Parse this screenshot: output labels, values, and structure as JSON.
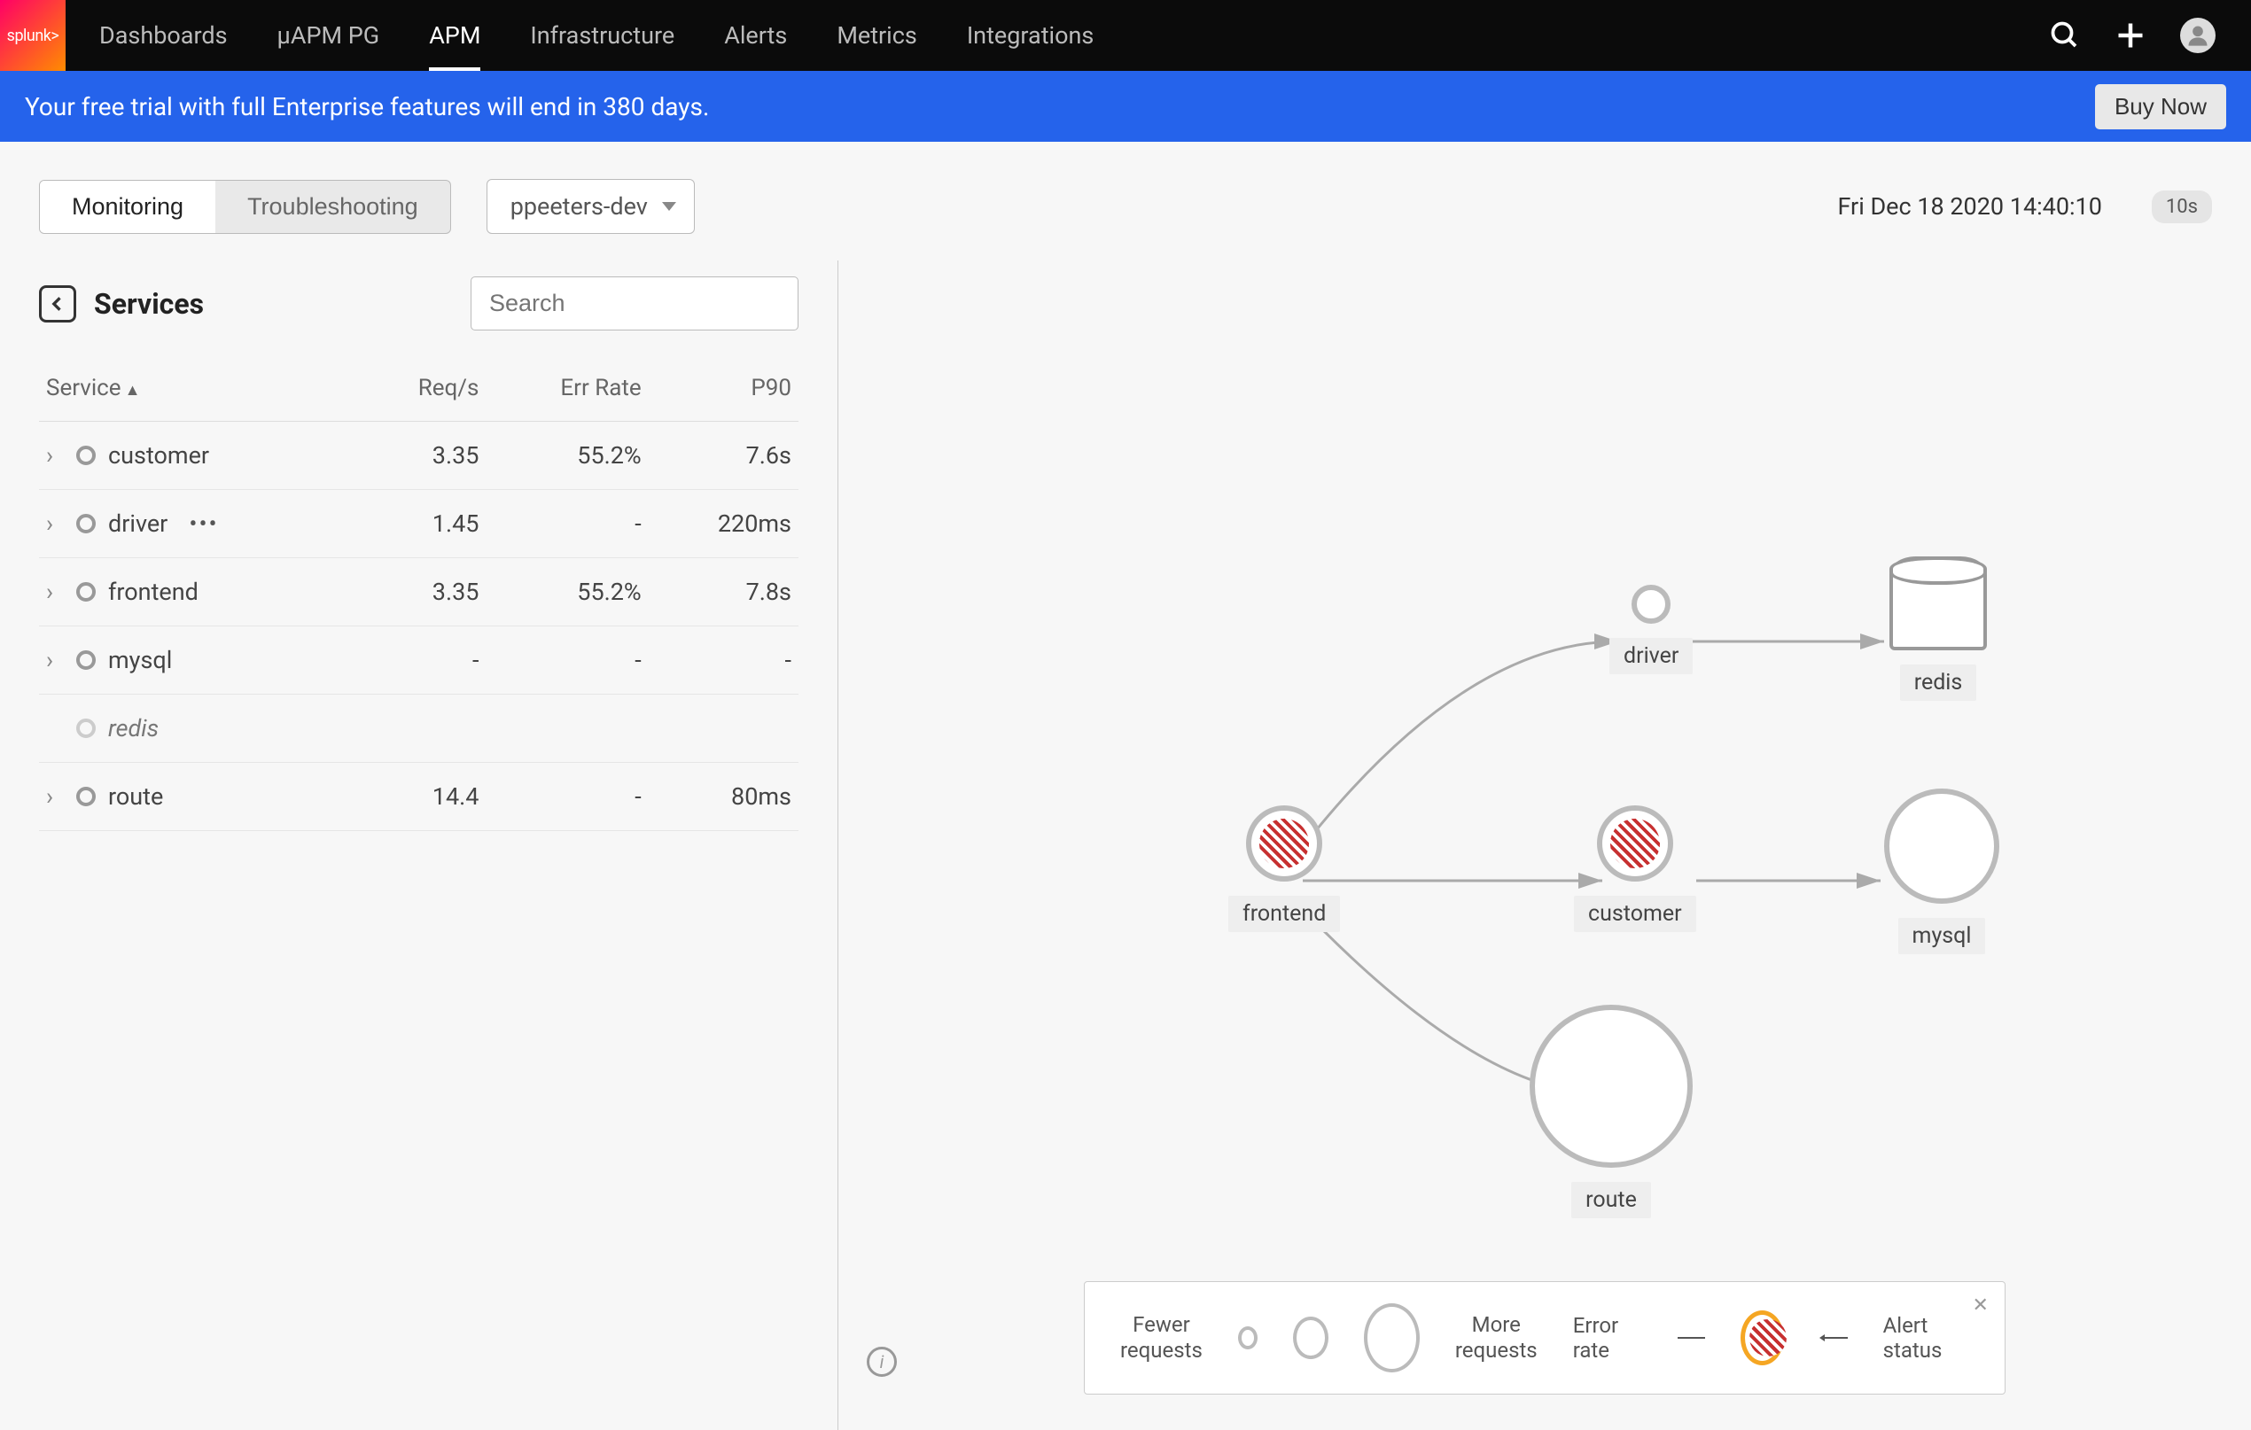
{
  "brand": "splunk>",
  "nav": {
    "items": [
      {
        "label": "Dashboards"
      },
      {
        "label": "µAPM PG"
      },
      {
        "label": "APM",
        "active": true
      },
      {
        "label": "Infrastructure"
      },
      {
        "label": "Alerts"
      },
      {
        "label": "Metrics"
      },
      {
        "label": "Integrations"
      }
    ]
  },
  "banner": {
    "text": "Your free trial with full Enterprise features will end in 380 days.",
    "cta": "Buy Now"
  },
  "toolbar": {
    "tabs": [
      {
        "label": "Monitoring",
        "active": true
      },
      {
        "label": "Troubleshooting"
      }
    ],
    "environment": "ppeeters-dev",
    "timestamp": "Fri Dec 18 2020 14:40:10",
    "refresh": "10s"
  },
  "sidebar": {
    "title": "Services",
    "search_placeholder": "Search",
    "columns": {
      "service": "Service",
      "reqs": "Req/s",
      "errrate": "Err Rate",
      "p90": "P90"
    },
    "rows": [
      {
        "name": "customer",
        "reqs": "3.35",
        "errrate": "55.2%",
        "p90": "7.6s",
        "expandable": true,
        "status": "normal"
      },
      {
        "name": "driver",
        "reqs": "1.45",
        "errrate": "-",
        "p90": "220ms",
        "expandable": true,
        "status": "normal",
        "menu": true
      },
      {
        "name": "frontend",
        "reqs": "3.35",
        "errrate": "55.2%",
        "p90": "7.8s",
        "expandable": true,
        "status": "normal"
      },
      {
        "name": "mysql",
        "reqs": "-",
        "errrate": "-",
        "p90": "-",
        "expandable": true,
        "status": "normal"
      },
      {
        "name": "redis",
        "reqs": "",
        "errrate": "",
        "p90": "",
        "expandable": false,
        "status": "faded",
        "italic": true
      },
      {
        "name": "route",
        "reqs": "14.4",
        "errrate": "-",
        "p90": "80ms",
        "expandable": true,
        "status": "normal"
      }
    ]
  },
  "map": {
    "nodes": {
      "frontend": {
        "label": "frontend",
        "error": true
      },
      "driver": {
        "label": "driver"
      },
      "customer": {
        "label": "customer",
        "error": true
      },
      "route": {
        "label": "route"
      },
      "redis": {
        "label": "redis"
      },
      "mysql": {
        "label": "mysql"
      }
    }
  },
  "legend": {
    "fewer": "Fewer\nrequests",
    "more": "More\nrequests",
    "error_rate": "Error rate",
    "alert_status": "Alert status"
  }
}
